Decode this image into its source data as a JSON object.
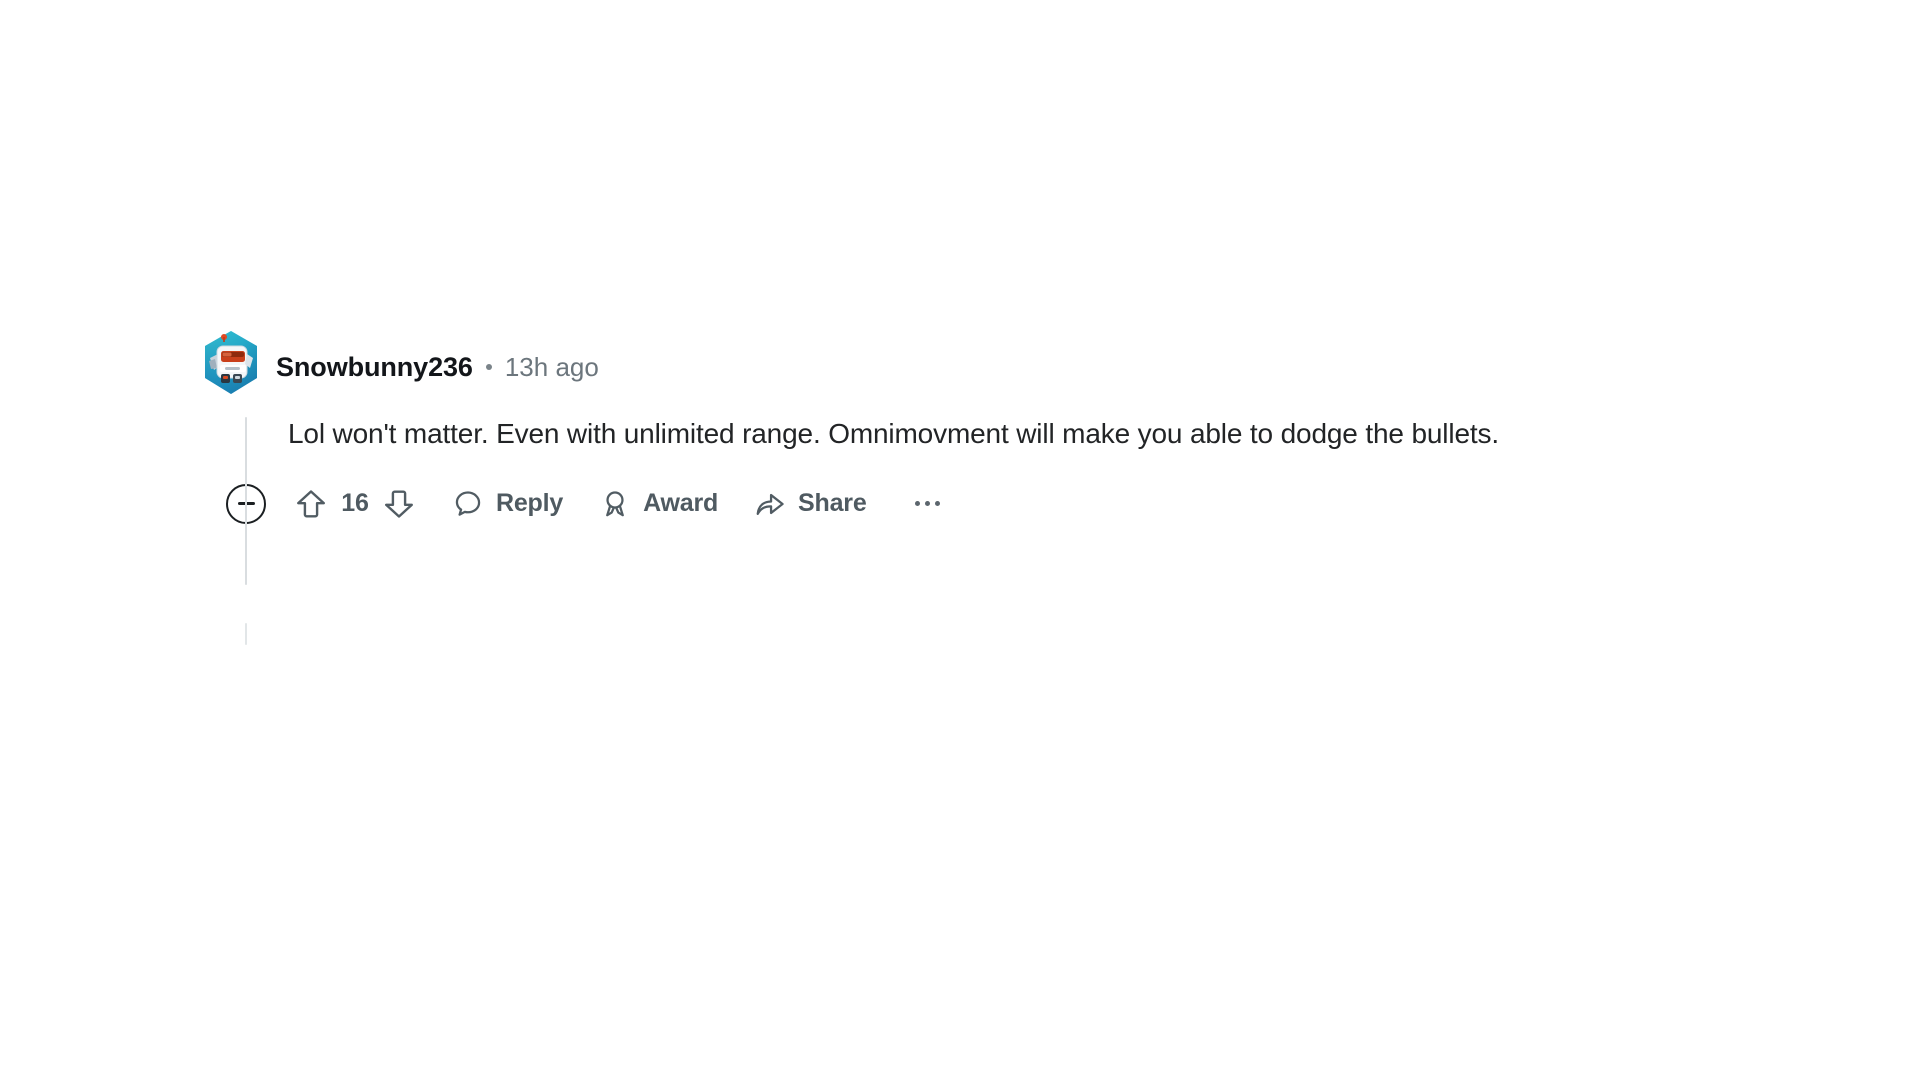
{
  "comment": {
    "author": "Snowbunny236",
    "separator": "•",
    "timestamp": "13h ago",
    "body": "Lol won't matter. Even with unlimited range. Omnimovment will make you able to dodge the bullets.",
    "avatar": {
      "icon": "reddit-snoo-avatar",
      "background_colors": [
        "#2fc5cf",
        "#1b86bd",
        "#0e5f99"
      ],
      "character_colors": [
        "#ffffff",
        "#d64a23",
        "#8c2f12",
        "#b9c4cc"
      ]
    }
  },
  "actions": {
    "collapse": {
      "icon": "minus-circle-icon",
      "label": ""
    },
    "upvote": {
      "icon": "upvote-arrow-icon",
      "label": ""
    },
    "vote_count": "16",
    "downvote": {
      "icon": "downvote-arrow-icon",
      "label": ""
    },
    "reply": {
      "icon": "comment-bubble-icon",
      "label": "Reply"
    },
    "award": {
      "icon": "award-medal-icon",
      "label": "Award"
    },
    "share": {
      "icon": "share-arrow-icon",
      "label": "Share"
    },
    "more": {
      "icon": "ellipsis-icon",
      "label": ""
    }
  },
  "colors": {
    "background": "#ffffff",
    "username": "#13161a",
    "meta": "#6c767d",
    "body_text": "#222426",
    "action_text": "#4f5a61",
    "thread_line": "#d9dde0"
  }
}
